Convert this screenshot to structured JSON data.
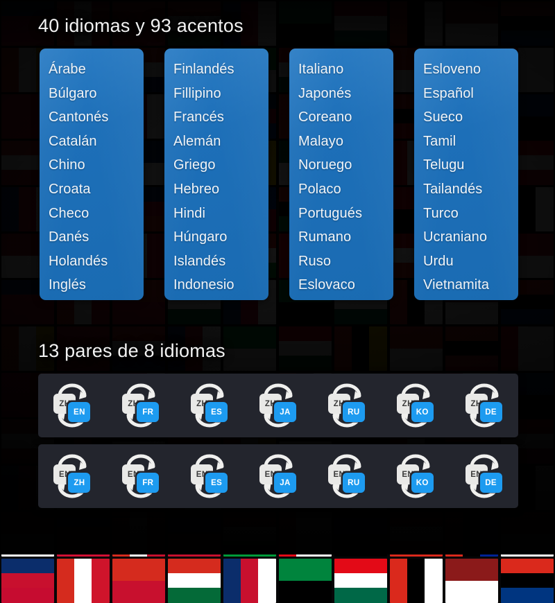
{
  "theme": {
    "panel_blue": "#1d6fb8",
    "pairs_panel_bg": "#23252d",
    "tile_source_bg": "#e9e9e7",
    "tile_target_bg": "#1d9ff0",
    "title_color": "#f2f2f2",
    "page_bg": "#060607"
  },
  "languages_section": {
    "title": "40 idiomas y 93 acentos",
    "columns": [
      {
        "name": "language-column-1",
        "items": [
          "Árabe",
          "Búlgaro",
          "Cantonés",
          "Catalán",
          "Chino",
          "Croata",
          "Checo",
          "Danés",
          "Holandés",
          "Inglés"
        ]
      },
      {
        "name": "language-column-2",
        "items": [
          "Finlandés",
          "Fillipino",
          "Francés",
          "Alemán",
          "Griego",
          "Hebreo",
          "Hindi",
          "Húngaro",
          "Islandés",
          "Indonesio"
        ]
      },
      {
        "name": "language-column-3",
        "items": [
          "Italiano",
          "Japonés",
          "Coreano",
          "Malayo",
          "Noruego",
          "Polaco",
          "Portugués",
          "Rumano",
          "Ruso",
          "Eslovaco"
        ]
      },
      {
        "name": "language-column-4",
        "items": [
          "Esloveno",
          "Español",
          "Sueco",
          "Tamil",
          "Telugu",
          "Tailandés",
          "Turco",
          "Ucraniano",
          "Urdu",
          "Vietnamita"
        ]
      }
    ]
  },
  "pairs_section": {
    "title": "13 pares de 8 idiomas",
    "swap_icon": "swap-arrows-icon",
    "rows": [
      {
        "name": "pairs-row-zh",
        "pairs": [
          {
            "source": "ZH",
            "target": "EN"
          },
          {
            "source": "ZH",
            "target": "FR"
          },
          {
            "source": "ZH",
            "target": "ES"
          },
          {
            "source": "ZH",
            "target": "JA"
          },
          {
            "source": "ZH",
            "target": "RU"
          },
          {
            "source": "ZH",
            "target": "KO"
          },
          {
            "source": "ZH",
            "target": "DE"
          }
        ]
      },
      {
        "name": "pairs-row-en",
        "pairs": [
          {
            "source": "EN",
            "target": "ZH"
          },
          {
            "source": "EN",
            "target": "FR"
          },
          {
            "source": "EN",
            "target": "ES"
          },
          {
            "source": "EN",
            "target": "JA"
          },
          {
            "source": "EN",
            "target": "RU"
          },
          {
            "source": "EN",
            "target": "KO"
          },
          {
            "source": "EN",
            "target": "DE"
          }
        ]
      }
    ]
  },
  "background": {
    "name": "world-flags-mosaic",
    "flag_colors": [
      [
        "#0b2d6b",
        "#c8102e"
      ],
      [
        "#ce1126",
        "#ffffff"
      ],
      [
        "#006847",
        "#ffffff"
      ],
      [
        "#012169",
        "#ffffff"
      ],
      [
        "#c60c30",
        "#ffffff"
      ],
      [
        "#e30a17",
        "#ffffff"
      ],
      [
        "#009b3a",
        "#ffdf00"
      ],
      [
        "#00247d",
        "#cf142b"
      ],
      [
        "#8b1a1a",
        "#f5d547"
      ],
      [
        "#006233",
        "#ffffff"
      ],
      [
        "#d52b1e",
        "#ffffff"
      ],
      [
        "#003580",
        "#ffffff"
      ],
      [
        "#0033a0",
        "#ffd100"
      ],
      [
        "#046a38",
        "#ffffff"
      ],
      [
        "#aa151b",
        "#f1bf00"
      ],
      [
        "#da291c",
        "#000000"
      ],
      [
        "#003da5",
        "#ffffff"
      ],
      [
        "#d21034",
        "#007a3d"
      ],
      [
        "#ed2939",
        "#002395"
      ],
      [
        "#00843d",
        "#ffffff"
      ]
    ]
  }
}
